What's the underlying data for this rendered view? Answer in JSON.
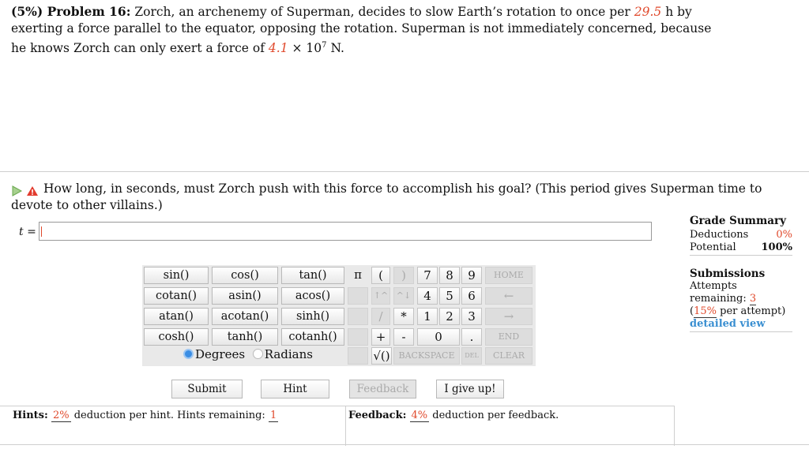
{
  "problem": {
    "header": "(5%) Problem 16:",
    "text_a": "Zorch, an archenemy of Superman, decides to slow Earth’s rotation to once per",
    "period_value": "29.5",
    "text_b": "h by exerting a force parallel to the equator, opposing the rotation. Superman is not immediately concerned, because he knows Zorch can only exert a force of",
    "force_value": "4.1",
    "force_mult": "× 10",
    "force_exp": "7",
    "force_unit": "N."
  },
  "question": {
    "text": "How long, in seconds, must Zorch push with this force to accomplish his goal? (This period gives Superman time to devote to other villains.)",
    "icons": [
      "play-arrow-icon",
      "warning-icon"
    ]
  },
  "answer": {
    "variable": "t",
    "equals": " =",
    "value": ""
  },
  "grade_summary": {
    "title": "Grade Summary",
    "deductions_label": "Deductions",
    "deductions_value": "0%",
    "potential_label": "Potential",
    "potential_value": "100%"
  },
  "submissions": {
    "title": "Submissions",
    "attempts_label": "Attempts remaining:",
    "attempts_value": "3",
    "per_attempt_open": "(",
    "per_attempt_pct": "15%",
    "per_attempt_rest": " per attempt)",
    "detailed_view": "detailed view"
  },
  "calculator": {
    "functions": [
      [
        "sin()",
        "cos()",
        "tan()"
      ],
      [
        "cotan()",
        "asin()",
        "acos()"
      ],
      [
        "atan()",
        "acotan()",
        "sinh()"
      ],
      [
        "cosh()",
        "tanh()",
        "cotanh()"
      ]
    ],
    "degrees": "Degrees",
    "radians": "Radians",
    "keys": {
      "pi": "π",
      "lparen": "(",
      "rparen": ")",
      "seven": "7",
      "eight": "8",
      "nine": "9",
      "home": "HOME",
      "up_arrow": "↑^",
      "down_arrow": "^↓",
      "four": "4",
      "five": "5",
      "six": "6",
      "left": "←",
      "slash": "/",
      "star": "*",
      "one": "1",
      "two": "2",
      "three": "3",
      "right": "→",
      "plus": "+",
      "minus": "-",
      "zero": "0",
      "dot": ".",
      "end": "END",
      "sqrt": "√()",
      "backspace": "BACKSPACE",
      "del": "DEL",
      "clear": "CLEAR"
    }
  },
  "actions": {
    "submit": "Submit",
    "hint": "Hint",
    "feedback": "Feedback",
    "give_up": "I give up!"
  },
  "hints": {
    "label": "Hints:",
    "pct": "2%",
    "text": "deduction per hint. Hints remaining:",
    "remaining": "1"
  },
  "feedback_info": {
    "label": "Feedback:",
    "pct": "4%",
    "text": "deduction per feedback."
  },
  "colors": {
    "accent_red": "#e0492c",
    "link_blue": "#3a8fd1",
    "radio_blue": "#3b8ee4"
  }
}
